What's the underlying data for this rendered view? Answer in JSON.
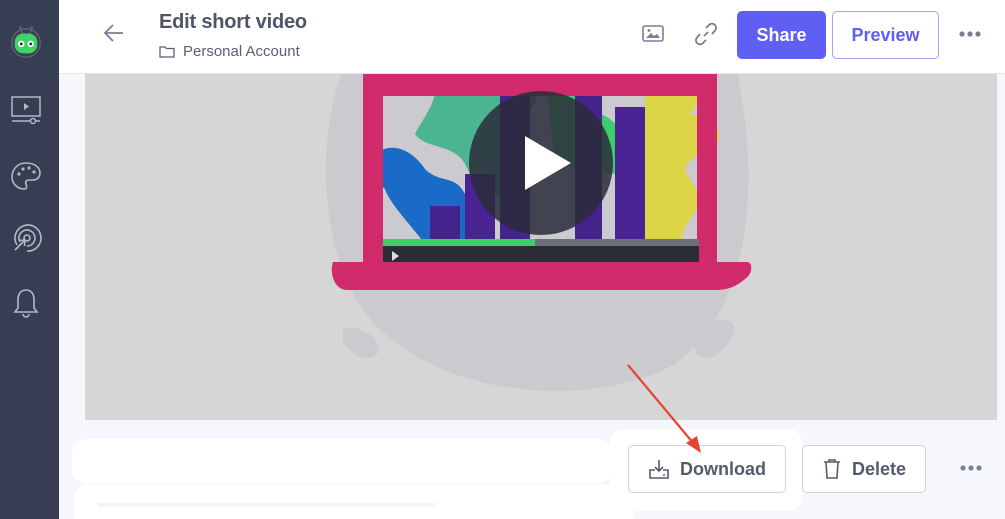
{
  "sidebar": {
    "logo": "robot-logo",
    "items": [
      {
        "name": "videos",
        "icon": "video-player-icon"
      },
      {
        "name": "branding",
        "icon": "palette-icon"
      },
      {
        "name": "campaigns",
        "icon": "target-click-icon"
      },
      {
        "name": "notifications",
        "icon": "bell-icon"
      }
    ]
  },
  "header": {
    "title": "Edit short video",
    "folder": "Personal Account",
    "share_label": "Share",
    "preview_label": "Preview"
  },
  "video": {
    "play_icon": "play-icon"
  },
  "actions": {
    "download_label": "Download",
    "delete_label": "Delete"
  },
  "colors": {
    "accent": "#5f5ff3",
    "sidebar": "#373d52",
    "annotation": "#e8432e"
  }
}
